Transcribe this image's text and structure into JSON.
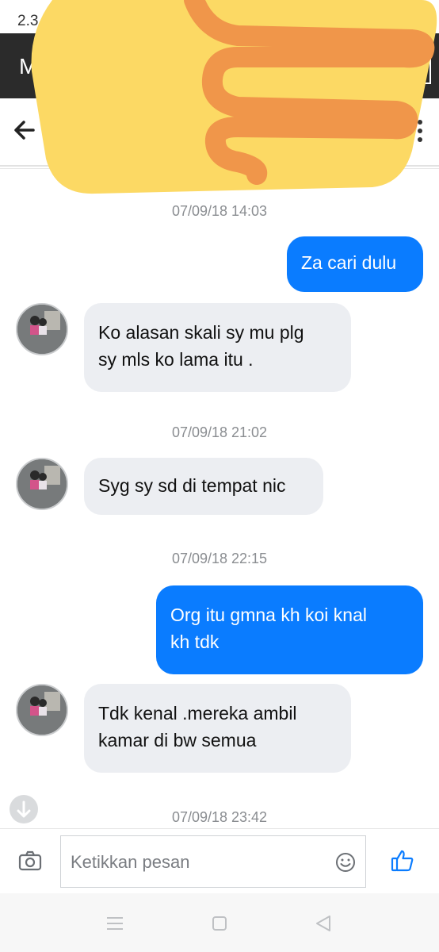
{
  "status_bar": {
    "time": "2.3"
  },
  "top_bar": {
    "letter": "M"
  },
  "messages": [
    {
      "kind": "timestamp",
      "text": "07/09/18 14:03"
    },
    {
      "kind": "out",
      "text": "Za cari dulu"
    },
    {
      "kind": "in",
      "lines": [
        "Ko alasan skali sy mu plg",
        "sy mls ko lama itu ."
      ]
    },
    {
      "kind": "timestamp",
      "text": "07/09/18 21:02"
    },
    {
      "kind": "in",
      "lines": [
        "Syg sy sd di tempat nic"
      ]
    },
    {
      "kind": "timestamp",
      "text": "07/09/18 22:15"
    },
    {
      "kind": "out",
      "lines": [
        "Org itu gmna kh koi knal",
        "kh tdk"
      ]
    },
    {
      "kind": "in",
      "lines": [
        "Tdk kenal .mereka ambil",
        "kamar di bw semua"
      ]
    },
    {
      "kind": "timestamp",
      "text": "07/09/18 23:42"
    }
  ],
  "composer": {
    "placeholder": "Ketikkan pesan"
  },
  "colors": {
    "accent": "#0a7cff",
    "incoming_bubble": "#eceef2",
    "sticker_yellow": "#fcd964",
    "sticker_orange": "#f0964a"
  },
  "icons": [
    "back-arrow-icon",
    "more-vert-icon",
    "camera-icon",
    "emoji-icon",
    "thumbs-up-icon",
    "arrow-down-icon",
    "menu-icon",
    "home-square-icon",
    "back-triangle-icon"
  ]
}
